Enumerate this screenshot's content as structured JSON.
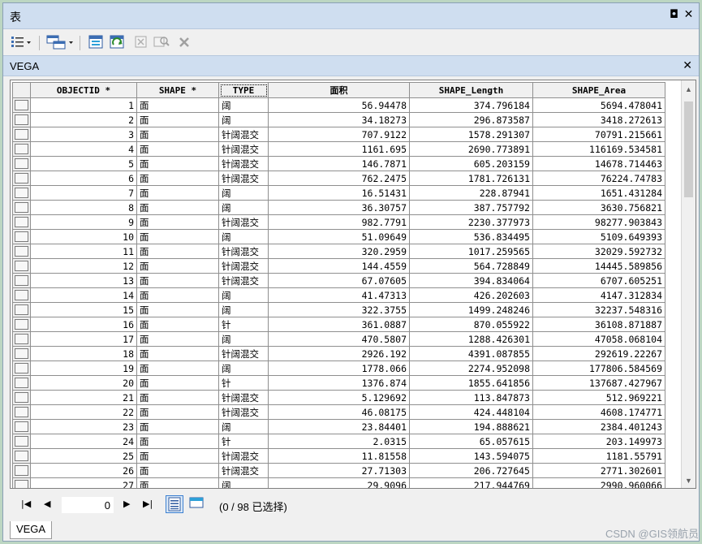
{
  "window": {
    "title": "表",
    "restore_glyph": "◘",
    "close_glyph": "✕"
  },
  "toolbar": {
    "icons": [
      "table-options-icon",
      "related-tables-icon",
      "select-by-attributes-icon",
      "switch-selection-icon",
      "clear-selection-icon",
      "zoom-to-selected-icon",
      "delete-selected-icon"
    ]
  },
  "tab": {
    "name": "VEGA",
    "close_glyph": "✕"
  },
  "table": {
    "columns": [
      "OBJECTID *",
      "SHAPE *",
      "TYPE",
      "面积",
      "SHAPE_Length",
      "SHAPE_Area"
    ],
    "rows": [
      [
        "1",
        "面",
        "阔",
        "56.94478",
        "374.796184",
        "5694.478041"
      ],
      [
        "2",
        "面",
        "阔",
        "34.18273",
        "296.873587",
        "3418.272613"
      ],
      [
        "3",
        "面",
        "针阔混交",
        "707.9122",
        "1578.291307",
        "70791.215661"
      ],
      [
        "4",
        "面",
        "针阔混交",
        "1161.695",
        "2690.773891",
        "116169.534581"
      ],
      [
        "5",
        "面",
        "针阔混交",
        "146.7871",
        "605.203159",
        "14678.714463"
      ],
      [
        "6",
        "面",
        "针阔混交",
        "762.2475",
        "1781.726131",
        "76224.74783"
      ],
      [
        "7",
        "面",
        "阔",
        "16.51431",
        "228.87941",
        "1651.431284"
      ],
      [
        "8",
        "面",
        "阔",
        "36.30757",
        "387.757792",
        "3630.756821"
      ],
      [
        "9",
        "面",
        "针阔混交",
        "982.7791",
        "2230.377973",
        "98277.903843"
      ],
      [
        "10",
        "面",
        "阔",
        "51.09649",
        "536.834495",
        "5109.649393"
      ],
      [
        "11",
        "面",
        "针阔混交",
        "320.2959",
        "1017.259565",
        "32029.592732"
      ],
      [
        "12",
        "面",
        "针阔混交",
        "144.4559",
        "564.728849",
        "14445.589856"
      ],
      [
        "13",
        "面",
        "针阔混交",
        "67.07605",
        "394.834064",
        "6707.605251"
      ],
      [
        "14",
        "面",
        "阔",
        "41.47313",
        "426.202603",
        "4147.312834"
      ],
      [
        "15",
        "面",
        "阔",
        "322.3755",
        "1499.248246",
        "32237.548316"
      ],
      [
        "16",
        "面",
        "针",
        "361.0887",
        "870.055922",
        "36108.871887"
      ],
      [
        "17",
        "面",
        "阔",
        "470.5807",
        "1288.426301",
        "47058.068104"
      ],
      [
        "18",
        "面",
        "针阔混交",
        "2926.192",
        "4391.087855",
        "292619.22267"
      ],
      [
        "19",
        "面",
        "阔",
        "1778.066",
        "2274.952098",
        "177806.584569"
      ],
      [
        "20",
        "面",
        "针",
        "1376.874",
        "1855.641856",
        "137687.427967"
      ],
      [
        "21",
        "面",
        "针阔混交",
        "5.129692",
        "113.847873",
        "512.969221"
      ],
      [
        "22",
        "面",
        "针阔混交",
        "46.08175",
        "424.448104",
        "4608.174771"
      ],
      [
        "23",
        "面",
        "阔",
        "23.84401",
        "194.888621",
        "2384.401243"
      ],
      [
        "24",
        "面",
        "针",
        "2.0315",
        "65.057615",
        "203.149973"
      ],
      [
        "25",
        "面",
        "针阔混交",
        "11.81558",
        "143.594075",
        "1181.55791"
      ],
      [
        "26",
        "面",
        "针阔混交",
        "27.71303",
        "206.727645",
        "2771.302601"
      ],
      [
        "27",
        "面",
        "阔",
        "29.9096",
        "217.944769",
        "2990.960066"
      ]
    ]
  },
  "navigation": {
    "first_glyph": "|◀",
    "prev_glyph": "◀",
    "record_value": "0",
    "next_glyph": "▶",
    "last_glyph": "▶|",
    "status": "(0 / 98 已选择)"
  },
  "sheet_tab": "VEGA",
  "watermark": "CSDN @GIS领航员"
}
